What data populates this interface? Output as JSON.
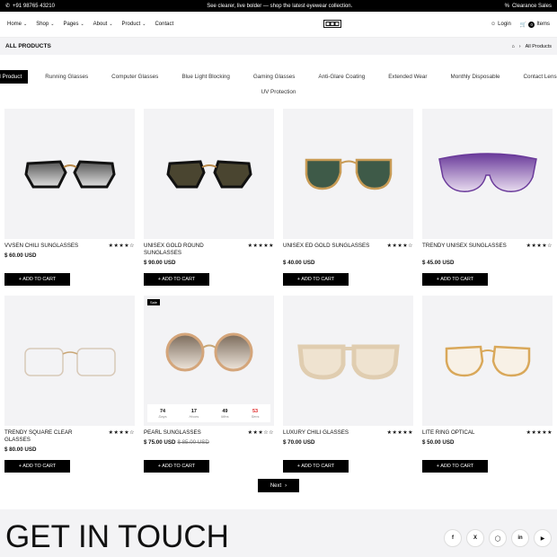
{
  "topbar": {
    "phone": "+91 98765 43210",
    "promo": "See clearer, live bolder — shop the latest eyewear collection.",
    "sale": "Clearance Sales"
  },
  "nav": {
    "items": [
      "Home",
      "Shop",
      "Pages",
      "About",
      "Product",
      "Contact"
    ],
    "login": "Login",
    "cart_count": "0",
    "cart_label": "Items"
  },
  "crumb": {
    "title": "ALL PRODUCTS",
    "current": "All Products"
  },
  "filters": [
    "All Product",
    "Running Glasses",
    "Computer Glasses",
    "Blue Light Blocking",
    "Gaming Glasses",
    "Anti-Glare Coating",
    "Extended Wear",
    "Monthly Disposable",
    "Contact Lenses",
    "UV Protection"
  ],
  "products": [
    {
      "name": "VVSEN CHILI SUNGLASSES",
      "price": "$ 60.00 USD",
      "stars": "★★★★☆",
      "rating": 4,
      "button": "+ ADD TO CART"
    },
    {
      "name": "UNISEX GOLD ROUND SUNGLASSES",
      "price": "$ 90.00 USD",
      "stars": "★★★★★",
      "rating": 5,
      "button": "+ ADD TO CART"
    },
    {
      "name": "UNISEX ED GOLD SUNGLASSES",
      "price": "$ 40.00 USD",
      "stars": "★★★★☆",
      "rating": 4,
      "button": "+ ADD TO CART"
    },
    {
      "name": "TRENDY UNISEX SUNGLASSES",
      "price": "$ 45.00 USD",
      "stars": "★★★★☆",
      "rating": 4,
      "button": "+ ADD TO CART"
    },
    {
      "name": "TRENDY SQUARE CLEAR GLASSES",
      "price": "$ 80.00 USD",
      "stars": "★★★★☆",
      "rating": 4,
      "button": "+ ADD TO CART"
    },
    {
      "name": "PEARL SUNGLASSES",
      "price": "$ 75.00 USD",
      "old_price": "$ 85.00 USD",
      "stars": "★★★☆☆",
      "rating": 3,
      "button": "+ ADD TO CART",
      "badge": "Sale",
      "countdown": [
        {
          "n": "74",
          "u": "Days"
        },
        {
          "n": "17",
          "u": "Hours"
        },
        {
          "n": "49",
          "u": "Mins"
        },
        {
          "n": "53",
          "u": "Secs"
        }
      ]
    },
    {
      "name": "LUXURY CHILI GLASSES",
      "price": "$ 70.00 USD",
      "stars": "★★★★★",
      "rating": 5,
      "button": "+ ADD TO CART"
    },
    {
      "name": "LITE RING OPTICAL",
      "price": "$ 50.00 USD",
      "stars": "★★★★★",
      "rating": 5,
      "button": "+ ADD TO CART"
    }
  ],
  "pagination": {
    "next": "Next"
  },
  "footer": {
    "title": "GET IN TOUCH",
    "social": [
      "facebook-icon",
      "x-icon",
      "instagram-icon",
      "linkedin-icon",
      "youtube-icon"
    ]
  },
  "colors": {
    "accent": "#000000",
    "tile_bg": "#f3f3f5",
    "secs": "#e02424"
  }
}
